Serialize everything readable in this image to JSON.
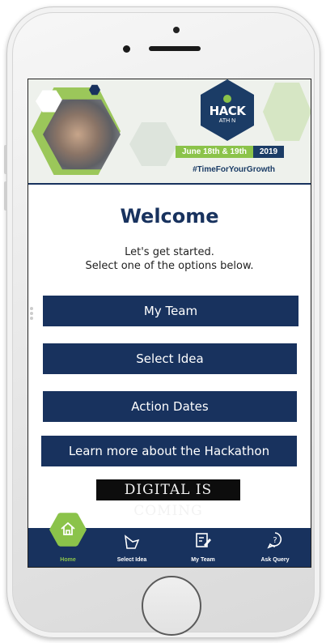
{
  "banner": {
    "logo_text": "HACK",
    "logo_sub": "ATH N",
    "dates": "June 18th & 19th",
    "year": "2019",
    "hashtag": "#TimeForYourGrowth"
  },
  "main": {
    "title": "Welcome",
    "subtitle_line1": "Let's get started.",
    "subtitle_line2": "Select one of the options below.",
    "buttons": [
      {
        "label": "My Team"
      },
      {
        "label": "Select Idea"
      },
      {
        "label": "Action Dates"
      },
      {
        "label": "Learn more about the Hackathon"
      }
    ],
    "footer_logo": "DIGITAL IS COMING"
  },
  "tabs": [
    {
      "label": "Home",
      "icon": "home-icon",
      "active": true
    },
    {
      "label": "Select Idea",
      "icon": "idea-icon"
    },
    {
      "label": "My Team",
      "icon": "edit-icon"
    },
    {
      "label": "Ask Query",
      "icon": "question-icon"
    }
  ],
  "colors": {
    "navy": "#18325e",
    "green": "#8bc34a"
  }
}
